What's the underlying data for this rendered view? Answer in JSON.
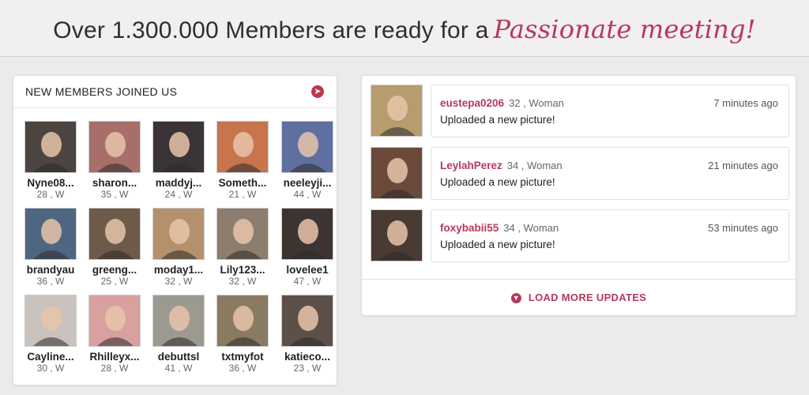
{
  "header": {
    "headline": "Over 1.300.000 Members are ready for a",
    "headline_script": "Passionate meeting!"
  },
  "new_members": {
    "title": "NEW MEMBERS JOINED US",
    "arrow_icon": "arrow-right-circle-icon",
    "members": [
      {
        "name": "Nyne08...",
        "meta": "28 , W",
        "tone": "#4b4440"
      },
      {
        "name": "sharon...",
        "meta": "35 , W",
        "tone": "#a86f6a"
      },
      {
        "name": "maddyj...",
        "meta": "24 , W",
        "tone": "#3a3436"
      },
      {
        "name": "Someth...",
        "meta": "21 , W",
        "tone": "#c8744d"
      },
      {
        "name": "neeleyji...",
        "meta": "44 , W",
        "tone": "#5f6fa0"
      },
      {
        "name": "brandyau",
        "meta": "36 , W",
        "tone": "#4f6682"
      },
      {
        "name": "greeng...",
        "meta": "25 , W",
        "tone": "#6e5a48"
      },
      {
        "name": "moday1...",
        "meta": "32 , W",
        "tone": "#b4906c"
      },
      {
        "name": "Lily123...",
        "meta": "32 , W",
        "tone": "#8d7d6f"
      },
      {
        "name": "lovelee1",
        "meta": "47 , W",
        "tone": "#3d3431"
      },
      {
        "name": "Cayline...",
        "meta": "30 , W",
        "tone": "#c9c2be"
      },
      {
        "name": "Rhilleyx...",
        "meta": "28 , W",
        "tone": "#d9a0a0"
      },
      {
        "name": "debuttsl",
        "meta": "41 , W",
        "tone": "#9c9a90"
      },
      {
        "name": "txtmyfot",
        "meta": "36 , W",
        "tone": "#8a7a62"
      },
      {
        "name": "katieco...",
        "meta": "23 , W",
        "tone": "#5c5048"
      }
    ]
  },
  "updates": {
    "items": [
      {
        "name": "eustepa0206",
        "info": "32 , Woman",
        "time": "7 minutes ago",
        "text": "Uploaded a new picture!",
        "tone": "#b79d6e"
      },
      {
        "name": "LeylahPerez",
        "info": "34 , Woman",
        "time": "21 minutes ago",
        "text": "Uploaded a new picture!",
        "tone": "#6b4a3c"
      },
      {
        "name": "foxybabii55",
        "info": "34 , Woman",
        "time": "53 minutes ago",
        "text": "Uploaded a new picture!",
        "tone": "#4a3a34"
      }
    ],
    "load_more": "LOAD MORE UPDATES",
    "load_more_icon": "download-circle-icon"
  },
  "colors": {
    "accent": "#b5395a",
    "background": "#ecebec"
  }
}
